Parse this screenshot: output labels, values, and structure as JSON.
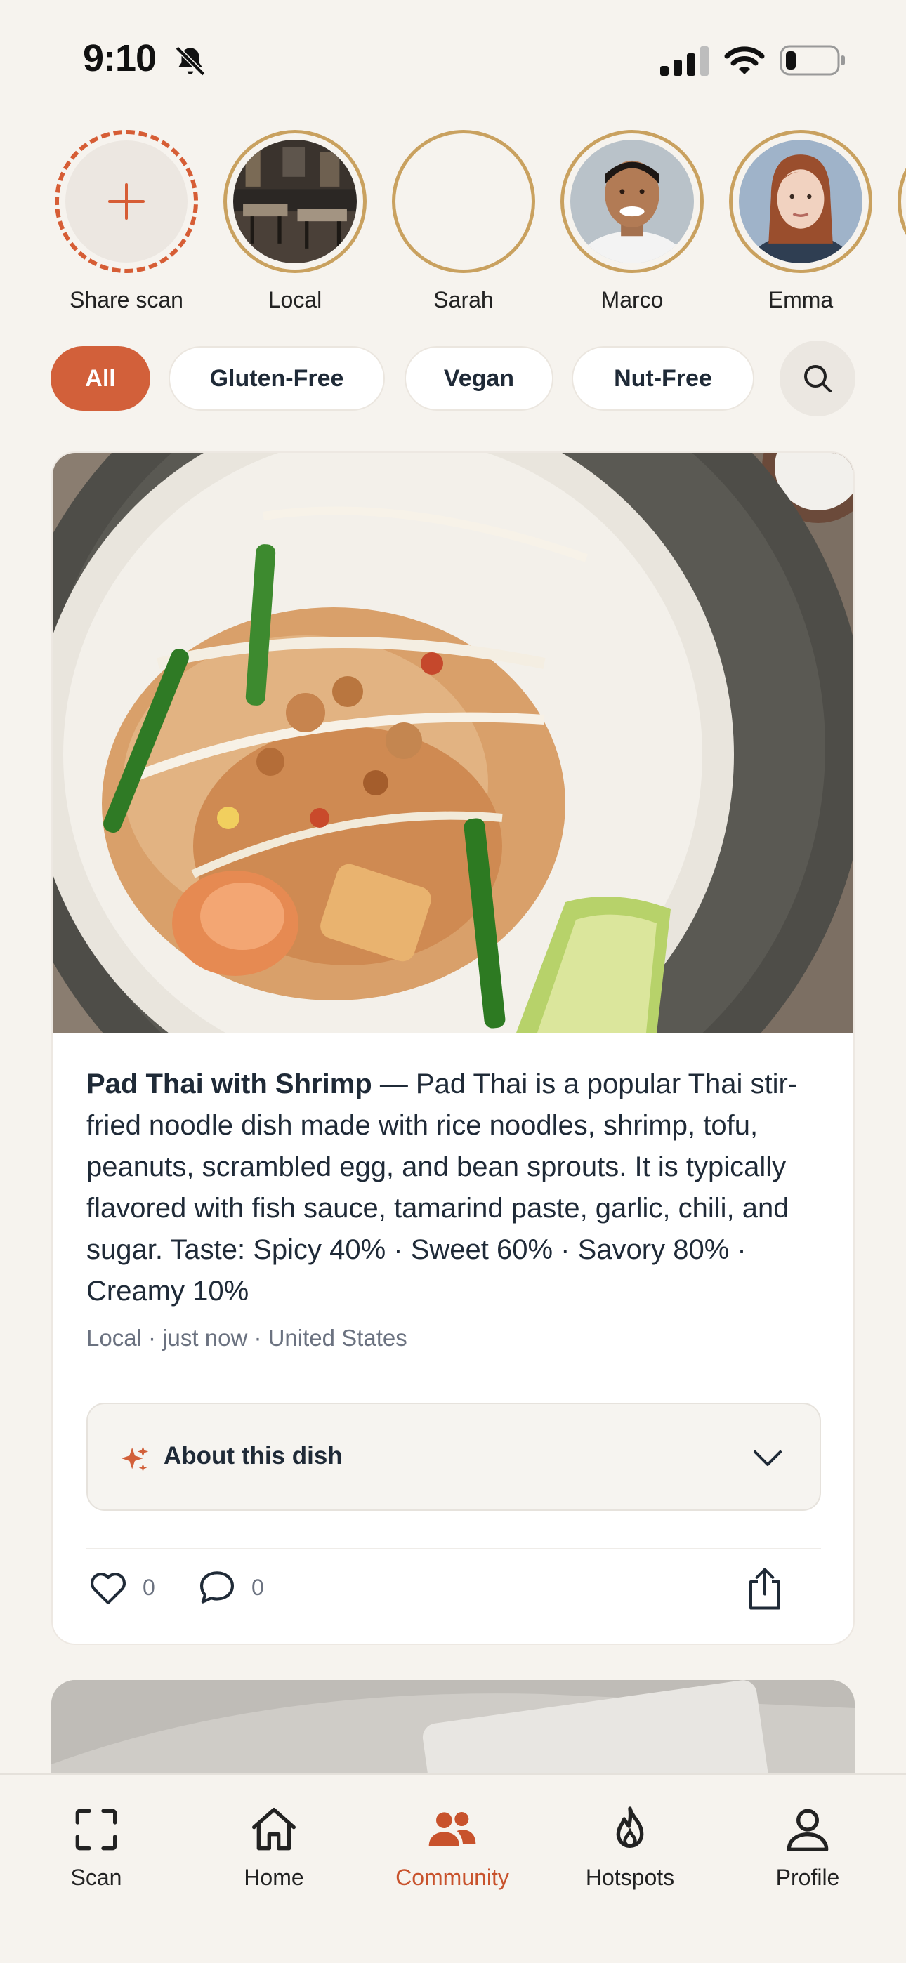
{
  "status_bar": {
    "time": "9:10"
  },
  "stories": [
    {
      "label": "Share scan",
      "type": "add"
    },
    {
      "label": "Local",
      "type": "photo"
    },
    {
      "label": "Sarah",
      "type": "empty"
    },
    {
      "label": "Marco",
      "type": "photo"
    },
    {
      "label": "Emma",
      "type": "photo"
    }
  ],
  "filters": [
    {
      "label": "All",
      "active": true
    },
    {
      "label": "Gluten-Free",
      "active": false
    },
    {
      "label": "Vegan",
      "active": false
    },
    {
      "label": "Nut-Free",
      "active": false
    }
  ],
  "post": {
    "dish_name": "Pad Thai with Shrimp",
    "description": " — Pad Thai is a popular Thai stir-fried noodle dish made with rice noodles, shrimp, tofu, peanuts, scrambled egg, and bean sprouts. It is typically flavored with fish sauce, tamarind paste, garlic, chili, and sugar. Taste: Spicy 40% · Sweet 60% · Savory 80% · Creamy 10%",
    "meta": "Local · just now · United States",
    "about_label": "About this dish",
    "likes": "0",
    "comments": "0"
  },
  "tabs": [
    {
      "label": "Scan",
      "icon": "scan-icon"
    },
    {
      "label": "Home",
      "icon": "home-icon"
    },
    {
      "label": "Community",
      "icon": "community-icon",
      "active": true
    },
    {
      "label": "Hotspots",
      "icon": "flame-icon"
    },
    {
      "label": "Profile",
      "icon": "profile-icon"
    }
  ],
  "colors": {
    "accent": "#d2603a",
    "ring": "#c9a15f",
    "background": "#f6f3ee"
  }
}
